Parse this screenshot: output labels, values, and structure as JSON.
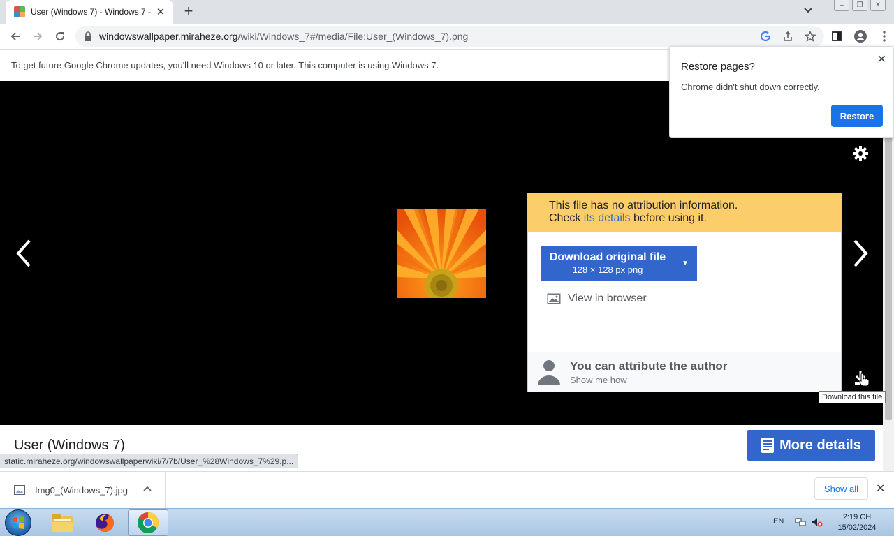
{
  "browser": {
    "tab_title": "User (Windows 7) - Windows 7 -",
    "url_domain": "windowswallpaper.miraheze.org",
    "url_path": "/wiki/Windows_7#/media/File:User_(Windows_7).png"
  },
  "infobar": {
    "text": "To get future Google Chrome updates, you'll need Windows 10 or later. This computer is using Windows 7."
  },
  "restore_bubble": {
    "title": "Restore pages?",
    "message": "Chrome didn't shut down correctly.",
    "button": "Restore"
  },
  "download_panel": {
    "warning_line1": "This file has no attribution information.",
    "warning_check": "Check ",
    "warning_link": "its details",
    "warning_after": " before using it.",
    "download_label": "Download original file",
    "download_sub": "128 × 128 px png",
    "view_in_browser": "View in browser",
    "attribute_title": "You can attribute the author",
    "attribute_sub": "Show me how"
  },
  "viewer": {
    "tooltip": "Download this file"
  },
  "page": {
    "title": "User (Windows 7)",
    "more_details": "More details"
  },
  "status_bar": {
    "url": "static.miraheze.org/windowswallpaperwiki/7/7b/User_%28Windows_7%29.p..."
  },
  "download_shelf": {
    "file_name": "Img0_(Windows_7).jpg",
    "show_all": "Show all"
  },
  "taskbar": {
    "language": "EN",
    "time": "2:19 CH",
    "date": "15/02/2024"
  },
  "colors": {
    "accent_blue": "#3366cc",
    "chrome_blue": "#1a73e8",
    "warning_yellow": "#fccd6b"
  }
}
